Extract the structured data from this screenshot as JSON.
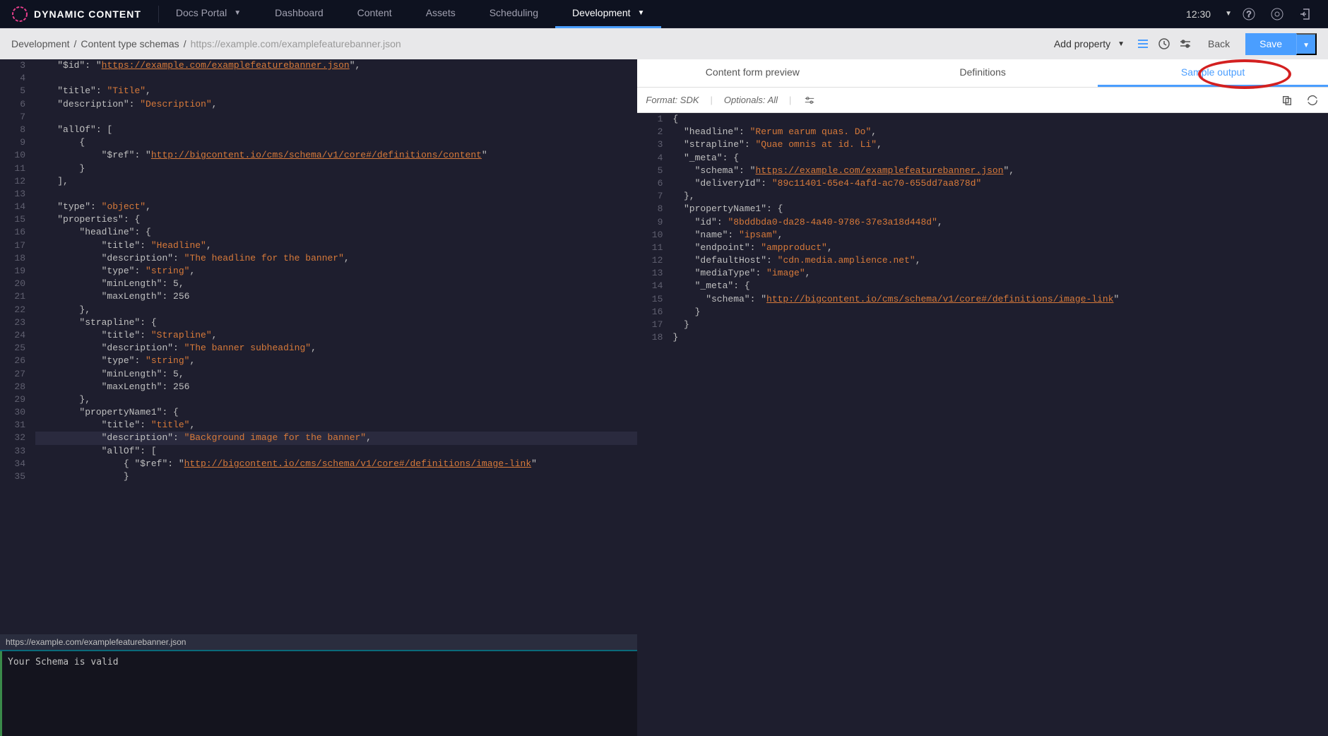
{
  "topbar": {
    "logo_text": "DYNAMIC CONTENT",
    "nav": [
      {
        "label": "Docs Portal",
        "has_dropdown": true
      },
      {
        "label": "Dashboard"
      },
      {
        "label": "Content"
      },
      {
        "label": "Assets"
      },
      {
        "label": "Scheduling"
      },
      {
        "label": "Development",
        "active": true,
        "has_dropdown": true
      }
    ],
    "time": "12:30"
  },
  "subbar": {
    "breadcrumb": {
      "a": "Development",
      "b": "Content type schemas",
      "c": "https://example.com/examplefeaturebanner.json"
    },
    "add_property": "Add property",
    "back": "Back",
    "save": "Save"
  },
  "left_editor": {
    "lines": [
      {
        "n": "3",
        "t": "    \"$id\": \"https://example.com/examplefeaturebanner.json\","
      },
      {
        "n": "4",
        "t": ""
      },
      {
        "n": "5",
        "t": "    \"title\": \"Title\","
      },
      {
        "n": "6",
        "t": "    \"description\": \"Description\","
      },
      {
        "n": "7",
        "t": ""
      },
      {
        "n": "8",
        "t": "    \"allOf\": ["
      },
      {
        "n": "9",
        "t": "        {"
      },
      {
        "n": "10",
        "t": "            \"$ref\": \"http://bigcontent.io/cms/schema/v1/core#/definitions/content\""
      },
      {
        "n": "11",
        "t": "        }"
      },
      {
        "n": "12",
        "t": "    ],"
      },
      {
        "n": "13",
        "t": ""
      },
      {
        "n": "14",
        "t": "    \"type\": \"object\","
      },
      {
        "n": "15",
        "t": "    \"properties\": {"
      },
      {
        "n": "16",
        "t": "        \"headline\": {"
      },
      {
        "n": "17",
        "t": "            \"title\": \"Headline\","
      },
      {
        "n": "18",
        "t": "            \"description\": \"The headline for the banner\","
      },
      {
        "n": "19",
        "t": "            \"type\": \"string\","
      },
      {
        "n": "20",
        "t": "            \"minLength\": 5,"
      },
      {
        "n": "21",
        "t": "            \"maxLength\": 256"
      },
      {
        "n": "22",
        "t": "        },"
      },
      {
        "n": "23",
        "t": "        \"strapline\": {"
      },
      {
        "n": "24",
        "t": "            \"title\": \"Strapline\","
      },
      {
        "n": "25",
        "t": "            \"description\": \"The banner subheading\","
      },
      {
        "n": "26",
        "t": "            \"type\": \"string\","
      },
      {
        "n": "27",
        "t": "            \"minLength\": 5,"
      },
      {
        "n": "28",
        "t": "            \"maxLength\": 256"
      },
      {
        "n": "29",
        "t": "        },"
      },
      {
        "n": "30",
        "t": "        \"propertyName1\": {"
      },
      {
        "n": "31",
        "t": "            \"title\": \"title\","
      },
      {
        "n": "32",
        "t": "            \"description\": \"Background image for the banner\",",
        "hl": true
      },
      {
        "n": "33",
        "t": "            \"allOf\": ["
      },
      {
        "n": "34",
        "t": "                { \"$ref\": \"http://bigcontent.io/cms/schema/v1/core#/definitions/image-link\""
      },
      {
        "n": "35",
        "t": "                }"
      }
    ],
    "footer": "https://example.com/examplefeaturebanner.json",
    "status": "Your Schema is valid"
  },
  "right_panel": {
    "tabs": {
      "a": "Content form preview",
      "b": "Definitions",
      "c": "Sample output"
    },
    "toolbar": {
      "format": "Format: SDK",
      "optionals": "Optionals: All"
    },
    "lines": [
      {
        "n": "1",
        "t": "{"
      },
      {
        "n": "2",
        "t": "  \"headline\": \"Rerum earum quas. Do\","
      },
      {
        "n": "3",
        "t": "  \"strapline\": \"Quae omnis at id. Li\","
      },
      {
        "n": "4",
        "t": "  \"_meta\": {"
      },
      {
        "n": "5",
        "t": "    \"schema\": \"https://example.com/examplefeaturebanner.json\","
      },
      {
        "n": "6",
        "t": "    \"deliveryId\": \"89c11401-65e4-4afd-ac70-655dd7aa878d\""
      },
      {
        "n": "7",
        "t": "  },"
      },
      {
        "n": "8",
        "t": "  \"propertyName1\": {"
      },
      {
        "n": "9",
        "t": "    \"id\": \"8bddbda0-da28-4a40-9786-37e3a18d448d\","
      },
      {
        "n": "10",
        "t": "    \"name\": \"ipsam\","
      },
      {
        "n": "11",
        "t": "    \"endpoint\": \"ampproduct\","
      },
      {
        "n": "12",
        "t": "    \"defaultHost\": \"cdn.media.amplience.net\","
      },
      {
        "n": "13",
        "t": "    \"mediaType\": \"image\","
      },
      {
        "n": "14",
        "t": "    \"_meta\": {"
      },
      {
        "n": "15",
        "t": "      \"schema\": \"http://bigcontent.io/cms/schema/v1/core#/definitions/image-link\""
      },
      {
        "n": "16",
        "t": "    }"
      },
      {
        "n": "17",
        "t": "  }"
      },
      {
        "n": "18",
        "t": "}"
      }
    ]
  }
}
